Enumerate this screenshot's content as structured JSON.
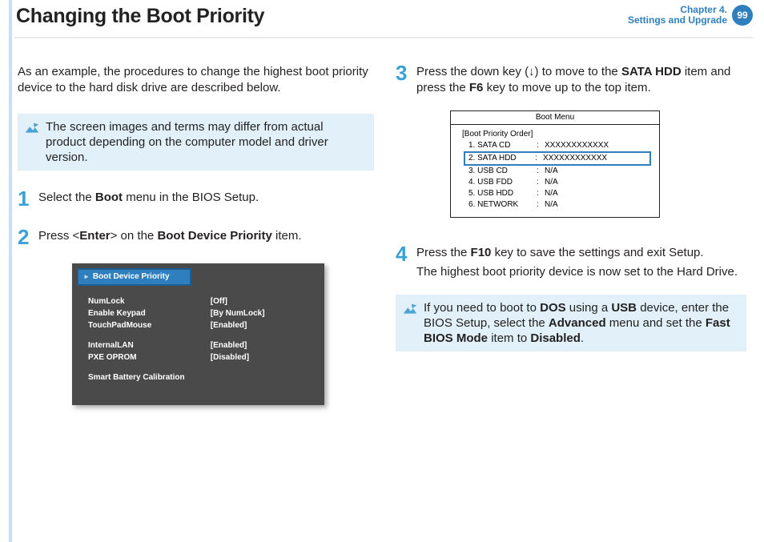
{
  "header": {
    "title": "Changing the Boot Priority",
    "chapter_line1": "Chapter 4.",
    "chapter_line2": "Settings and Upgrade",
    "page_number": "99"
  },
  "col1": {
    "intro": "As an example, the procedures to change the highest boot priority device to the hard disk drive are described below.",
    "note": "The screen images and terms may differ from actual product depending on the computer model and driver version.",
    "step1": {
      "num": "1",
      "text_a": "Select the ",
      "bold_a": "Boot",
      "text_b": " menu in the BIOS Setup."
    },
    "step2": {
      "num": "2",
      "text_a": "Press <",
      "bold_a": "Enter",
      "text_b": "> on the ",
      "bold_b": "Boot Device Priority",
      "text_c": " item."
    }
  },
  "bios_panel": {
    "highlight": "Boot Device Priority",
    "rows": [
      {
        "k": "NumLock",
        "v": "[Off]"
      },
      {
        "k": "Enable Keypad",
        "v": "[By NumLock]"
      },
      {
        "k": "TouchPadMouse",
        "v": "[Enabled]"
      },
      {
        "k": "InternalLAN",
        "v": "[Enabled]"
      },
      {
        "k": "PXE OPROM",
        "v": "[Disabled]"
      },
      {
        "k": "Smart Battery Calibration",
        "v": ""
      }
    ]
  },
  "col2": {
    "step3": {
      "num": "3",
      "text_a": "Press the down key (↓) to move to the ",
      "bold_a": "SATA HDD",
      "text_b": " item and press the ",
      "bold_b": "F6",
      "text_c": " key to move up to the top item."
    },
    "step4": {
      "num": "4",
      "text_a": "Press the ",
      "bold_a": "F10",
      "text_b": " key to save the settings and exit Setup.",
      "text_c": "The highest boot priority device is now set to the Hard Drive."
    },
    "note2": {
      "a": "If you need to boot to ",
      "b1": "DOS",
      "c": " using a ",
      "b2": "USB",
      "d": " device, enter the BIOS Setup, select the ",
      "b3": "Advanced",
      "e": " menu and set the ",
      "b4": "Fast BIOS Mode",
      "f": " item to ",
      "b5": "Disabled",
      "g": "."
    }
  },
  "boot_menu": {
    "title": "Boot Menu",
    "subtitle": "[Boot Priority Order]",
    "rows": [
      {
        "label": "1. SATA CD",
        "value": "XXXXXXXXXXXX"
      },
      {
        "label": "2. SATA HDD",
        "value": "XXXXXXXXXXXX"
      },
      {
        "label": "3. USB CD",
        "value": "N/A"
      },
      {
        "label": "4. USB FDD",
        "value": "N/A"
      },
      {
        "label": "5. USB HDD",
        "value": "N/A"
      },
      {
        "label": "6. NETWORK",
        "value": "N/A"
      }
    ]
  }
}
